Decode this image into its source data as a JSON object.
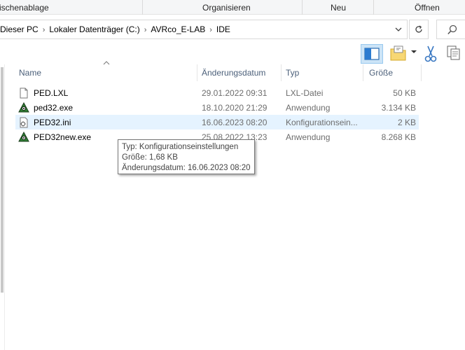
{
  "ribbon": {
    "groups": [
      "ischenablage",
      "Organisieren",
      "Neu",
      "Öffnen"
    ]
  },
  "address": {
    "crumbs": [
      "Dieser PC",
      "Lokaler Datenträger (C:)",
      "AVRco_E-LAB",
      "IDE"
    ],
    "separator": "›",
    "dropdown_icon": "chevron-down-icon",
    "refresh_icon": "refresh-icon",
    "search_icon": "search-icon"
  },
  "columns": {
    "name": "Name",
    "date": "Änderungsdatum",
    "type": "Typ",
    "size": "Größe"
  },
  "files": [
    {
      "name": "PED.LXL",
      "date": "29.01.2022 09:31",
      "type": "LXL-Datei",
      "size": "50 KB",
      "icon": "document-icon",
      "selected": false
    },
    {
      "name": "ped32.exe",
      "date": "18.10.2020 21:29",
      "type": "Anwendung",
      "size": "3.134 KB",
      "icon": "exe-app-icon",
      "selected": false
    },
    {
      "name": "PED32.ini",
      "date": "16.06.2023 08:20",
      "type": "Konfigurationsein...",
      "size": "2 KB",
      "icon": "settings-file-icon",
      "selected": true
    },
    {
      "name": "PED32new.exe",
      "date": "25.08.2022 13:23",
      "type": "Anwendung",
      "size": "8.268 KB",
      "icon": "exe-app-icon",
      "selected": false
    }
  ],
  "tooltip": {
    "line1": "Typ: Konfigurationseinstellungen",
    "line2": "Größe: 1,68 KB",
    "line3": "Änderungsdatum: 16.06.2023 08:20"
  },
  "colors": {
    "selection": "#e5f3ff",
    "header_text": "#4c607a",
    "preview_button": "#cce4f7"
  }
}
